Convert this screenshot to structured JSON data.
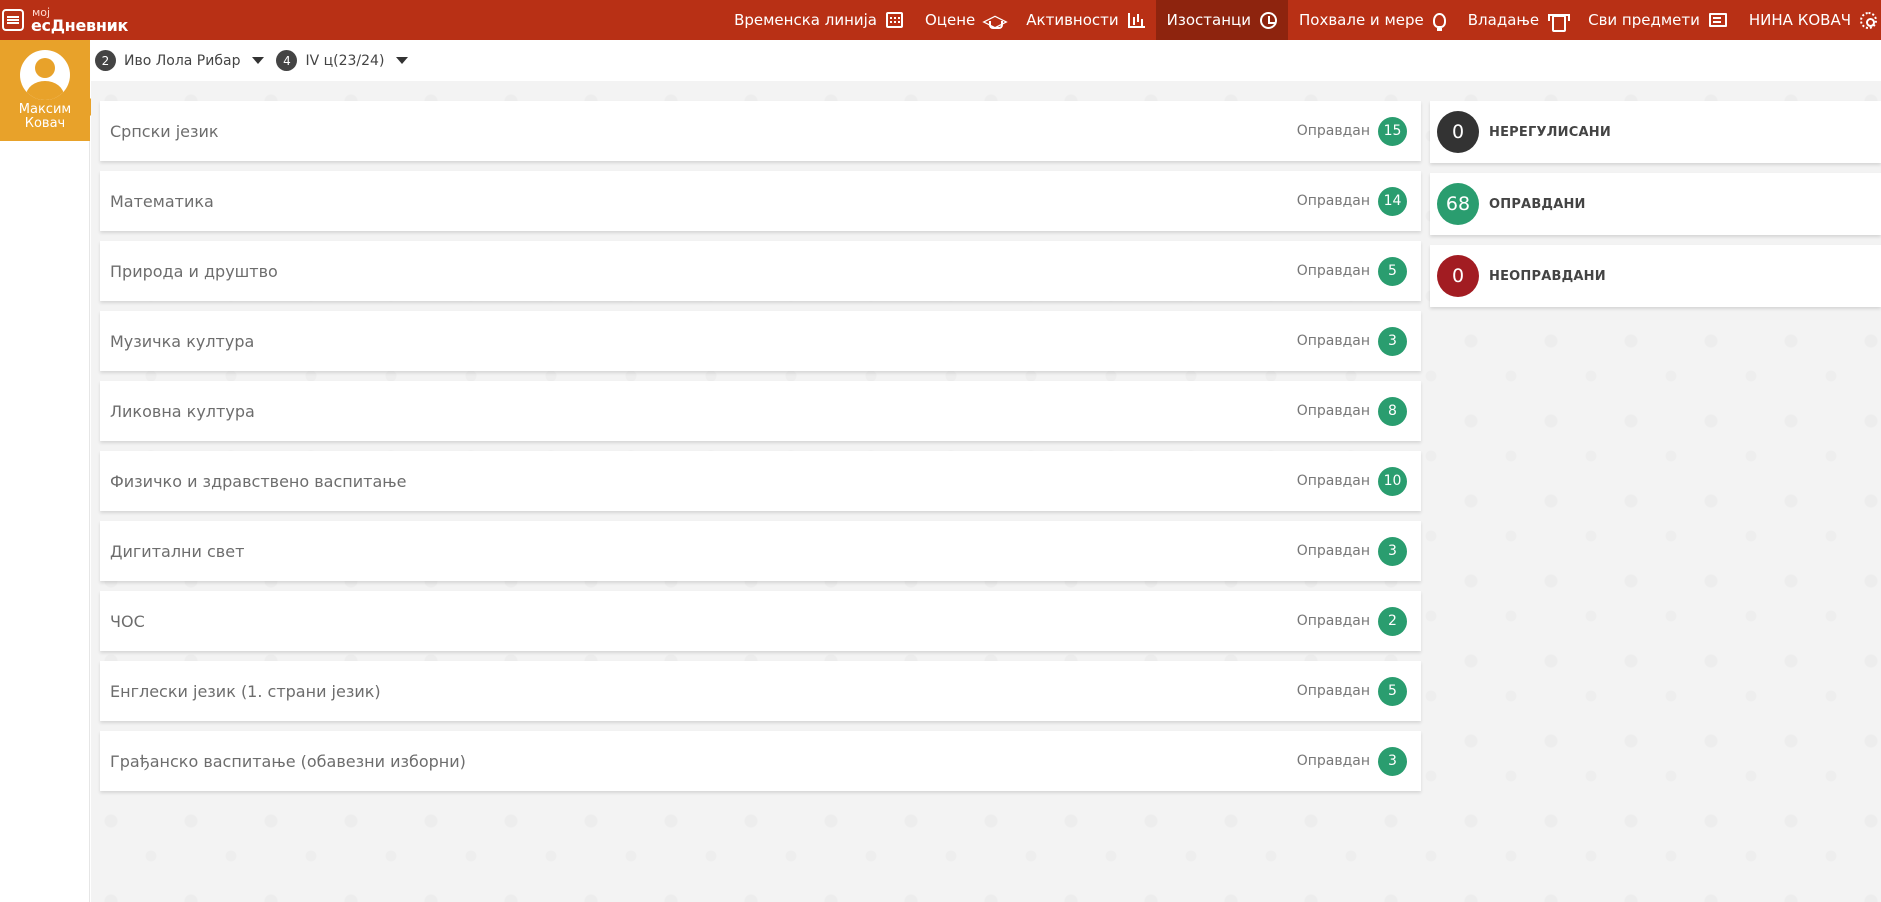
{
  "brand": {
    "small": "мој",
    "big": "есДневник"
  },
  "nav": {
    "items": [
      {
        "label": "Временска линија",
        "icon": "calendar-icon",
        "active": false
      },
      {
        "label": "Оцене",
        "icon": "graduation-cap-icon",
        "active": false
      },
      {
        "label": "Активности",
        "icon": "bar-chart-icon",
        "active": false
      },
      {
        "label": "Изостанци",
        "icon": "alarm-clock-icon",
        "active": true
      },
      {
        "label": "Похвале и мере",
        "icon": "lightbulb-icon",
        "active": false
      },
      {
        "label": "Владање",
        "icon": "shirt-icon",
        "active": false
      },
      {
        "label": "Сви предмети",
        "icon": "presentation-board-icon",
        "active": false
      }
    ],
    "user": {
      "label": "НИНА КОВАЧ",
      "icon": "gear-icon"
    }
  },
  "student": {
    "first_name": "Максим",
    "last_name": "Ковач"
  },
  "selectors": {
    "school": {
      "number": "2",
      "label": "Иво Лола Рибар"
    },
    "class": {
      "number": "4",
      "label": "IV ц(23/24)"
    }
  },
  "absences": [
    {
      "subject": "Српски језик",
      "status": "Оправдан",
      "count": "15"
    },
    {
      "subject": "Математика",
      "status": "Оправдан",
      "count": "14"
    },
    {
      "subject": "Природа и друштво",
      "status": "Оправдан",
      "count": "5"
    },
    {
      "subject": "Музичка култура",
      "status": "Оправдан",
      "count": "3"
    },
    {
      "subject": "Ликовна култура",
      "status": "Оправдан",
      "count": "8"
    },
    {
      "subject": "Физичко и здравствено васпитање",
      "status": "Оправдан",
      "count": "10"
    },
    {
      "subject": "Дигитални свет",
      "status": "Оправдан",
      "count": "3"
    },
    {
      "subject": "ЧОС",
      "status": "Оправдан",
      "count": "2"
    },
    {
      "subject": "Енглески језик (1. страни језик)",
      "status": "Оправдан",
      "count": "5"
    },
    {
      "subject": "Грађанско васпитање (обавезни изборни)",
      "status": "Оправдан",
      "count": "3"
    }
  ],
  "summary": [
    {
      "count": "0",
      "label": "НЕРЕГУЛИСАНИ",
      "color": "#333333"
    },
    {
      "count": "68",
      "label": "ОПРАВДАНИ",
      "color": "#2a9d6f"
    },
    {
      "count": "0",
      "label": "НЕОПРАВДАНИ",
      "color": "#a21c22"
    }
  ],
  "colors": {
    "topbar": "#b83015",
    "topbar_active": "#8e240e",
    "student_card": "#e8a22a",
    "justified_badge": "#2a9d6f"
  }
}
